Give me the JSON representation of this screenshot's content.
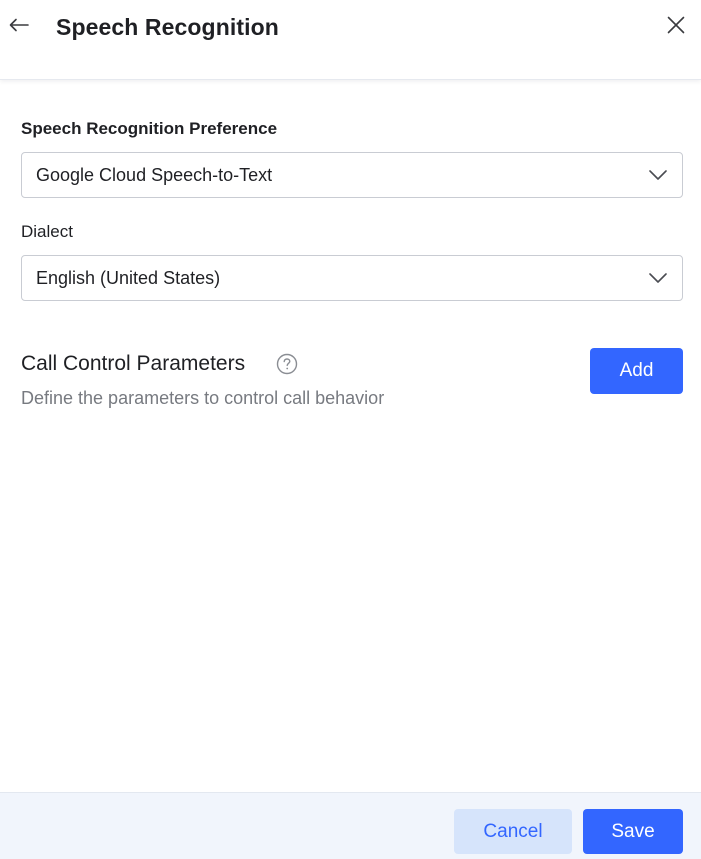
{
  "header": {
    "title": "Speech Recognition",
    "back_icon": "arrow-left-icon",
    "close_icon": "close-icon"
  },
  "form": {
    "preference": {
      "label": "Speech Recognition Preference",
      "value": "Google Cloud Speech-to-Text"
    },
    "dialect": {
      "label": "Dialect",
      "value": "English (United States)"
    }
  },
  "call_control": {
    "title": "Call Control Parameters",
    "description": "Define the parameters to control call behavior",
    "add_label": "Add",
    "help_icon": "question-circle-icon"
  },
  "footer": {
    "cancel_label": "Cancel",
    "save_label": "Save"
  },
  "colors": {
    "primary": "#3366ff",
    "secondary_button_bg": "#d6e4fb",
    "footer_bg": "#f1f5fc",
    "muted_text": "#777a80"
  }
}
